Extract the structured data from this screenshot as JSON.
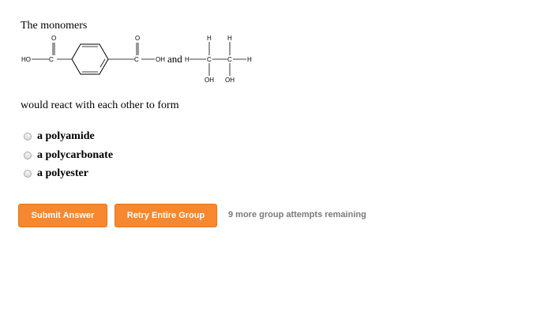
{
  "question": {
    "intro": "The monomers",
    "outro": "would react with each other to form"
  },
  "structures": {
    "left": {
      "ho": "HO",
      "c1": "C",
      "o1": "O",
      "c2": "C",
      "o2": "O",
      "oh": "OH"
    },
    "joiner": "and",
    "right": {
      "h_left": "H",
      "h_top1": "H",
      "h_top2": "H",
      "c1": "C",
      "c2": "C",
      "h_right": "H",
      "oh1": "OH",
      "oh2": "OH"
    }
  },
  "choices": [
    {
      "label": "a polyamide"
    },
    {
      "label": "a polycarbonate"
    },
    {
      "label": "a polyester"
    }
  ],
  "buttons": {
    "submit": "Submit Answer",
    "retry": "Retry Entire Group"
  },
  "attempts_text": "9 more group attempts remaining",
  "colors": {
    "button": "#f7882f",
    "button_text": "#ffffff",
    "muted_text": "#7a7a7a"
  }
}
